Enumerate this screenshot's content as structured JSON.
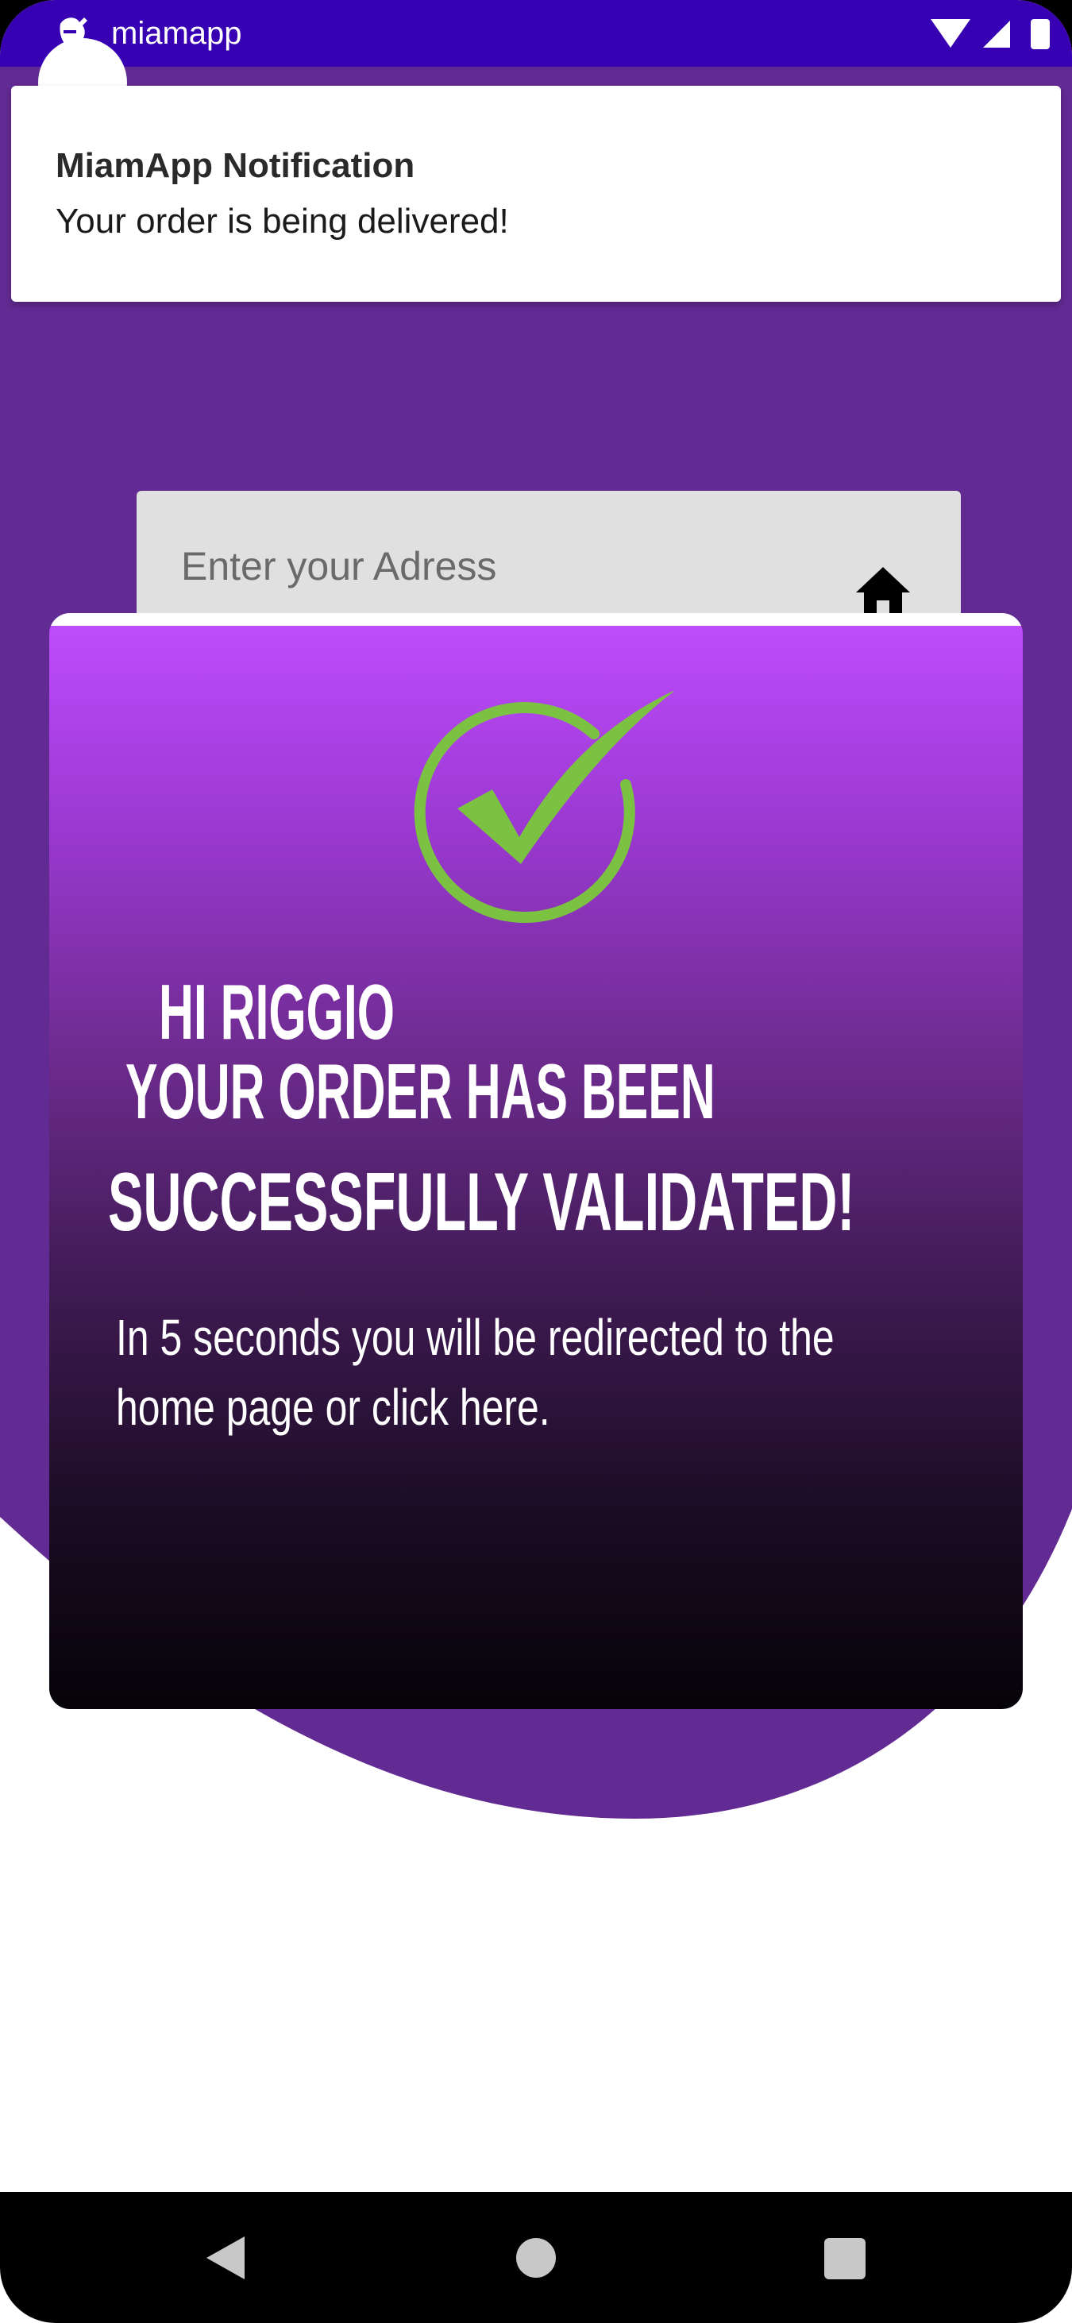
{
  "status_bar": {
    "app_name": "miamapp",
    "app_icon": "app-notification-icon",
    "icons": [
      "wifi-icon",
      "cell-signal-icon",
      "battery-icon"
    ],
    "color": "#3700b3"
  },
  "notification": {
    "title": "MiamApp Notification",
    "body": "Your order is being delivered!"
  },
  "address_field": {
    "placeholder": "Enter your Adress",
    "icon": "home-icon"
  },
  "dialog": {
    "icon": "check-circle-icon",
    "greeting": "HI RIGGIO",
    "headline_line1": "YOUR ORDER HAS BEEN",
    "headline_line2": "SUCCESSFULLY VALIDATED!",
    "redirect_text": " In 5 seconds you will be redirected to the home page or ",
    "redirect_link": "click here.",
    "gradient_top": "#c04dff",
    "gradient_bottom": "#050308",
    "check_color": "#7cc242"
  },
  "nav_bar": {
    "back_icon": "back-triangle-icon",
    "home_icon": "home-circle-icon",
    "recents_icon": "recents-square-icon"
  },
  "colors": {
    "purple_bg": "#622a93",
    "white": "#ffffff"
  }
}
